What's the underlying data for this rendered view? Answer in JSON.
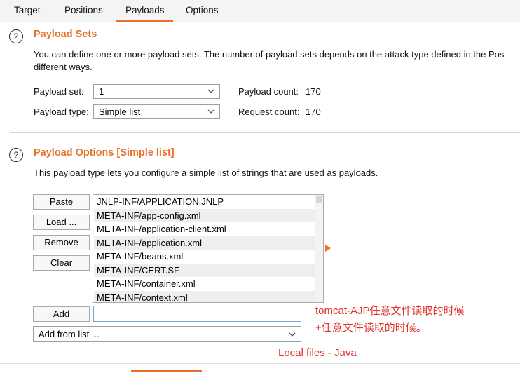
{
  "tabs": [
    {
      "label": "Target"
    },
    {
      "label": "Positions"
    },
    {
      "label": "Payloads"
    },
    {
      "label": "Options"
    }
  ],
  "active_tab": "Payloads",
  "payload_sets": {
    "help_glyph": "?",
    "title": "Payload Sets",
    "description_line1": "You can define one or more payload sets. The number of payload sets depends on the attack type defined in the Pos",
    "description_line2": "different ways.",
    "payload_set_label": "Payload set:",
    "payload_set_value": "1",
    "payload_count_label": "Payload count:",
    "payload_count": "170",
    "payload_type_label": "Payload type:",
    "payload_type_value": "Simple list",
    "request_count_label": "Request count:",
    "request_count": "170"
  },
  "payload_options": {
    "help_glyph": "?",
    "title": "Payload Options [Simple list]",
    "description": "This payload type lets you configure a simple list of strings that are used as payloads.",
    "buttons": {
      "paste": "Paste",
      "load": "Load ...",
      "remove": "Remove",
      "clear": "Clear",
      "add": "Add"
    },
    "list_items": [
      "JNLP-INF/APPLICATION.JNLP",
      "META-INF/app-config.xml",
      "META-INF/application-client.xml",
      "META-INF/application.xml",
      "META-INF/beans.xml",
      "META-INF/CERT.SF",
      "META-INF/container.xml",
      "META-INF/context.xml"
    ],
    "add_input_value": "",
    "add_from_list_value": "Add from list ..."
  },
  "annotations": {
    "line1": "tomcat-AJP任意文件读取的时候",
    "line2": "+任意文件读取的时候。",
    "line3": "Local files - Java"
  },
  "colors": {
    "accent": "#e8712a",
    "annotation_red": "#e0322b"
  },
  "icons": {
    "help": "help-circle-icon",
    "dropdown": "chevron-down-icon",
    "expand": "triangle-right-icon"
  }
}
